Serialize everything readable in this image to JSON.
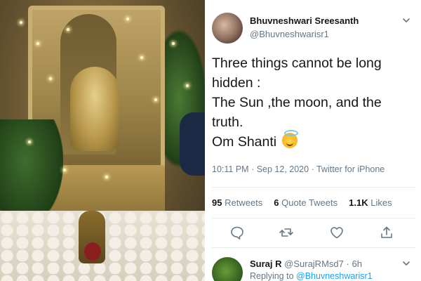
{
  "tweet": {
    "author_name": "Bhuvneshwari Sreesanth",
    "author_handle": "@Bhuvneshwarisr1",
    "text_lines": [
      "Three things cannot be long",
      "hidden :",
      "The Sun ,the moon, and the",
      "truth.",
      "Om Shanti"
    ],
    "emoji": "smiling-face-with-halo",
    "time": "10:11 PM",
    "date": "Sep 12, 2020",
    "source": "Twitter for iPhone",
    "retweets_count": "95",
    "retweets_label": "Retweets",
    "quote_tweets_count": "6",
    "quote_tweets_label": "Quote Tweets",
    "likes_count": "1.1K",
    "likes_label": "Likes"
  },
  "reply": {
    "author_name": "Suraj R",
    "author_handle": "@SurajRMsd7",
    "age": "6h",
    "replying_prefix": "Replying to",
    "replying_to": "@Bhuvneshwarisr1"
  },
  "icons": {
    "reply": "reply-icon",
    "retweet": "retweet-icon",
    "like": "heart-icon",
    "share": "share-icon",
    "more": "chevron-down-icon"
  },
  "colors": {
    "text": "#14171a",
    "muted": "#657786",
    "accent": "#1da1f2",
    "divider": "#e6ecf0"
  }
}
